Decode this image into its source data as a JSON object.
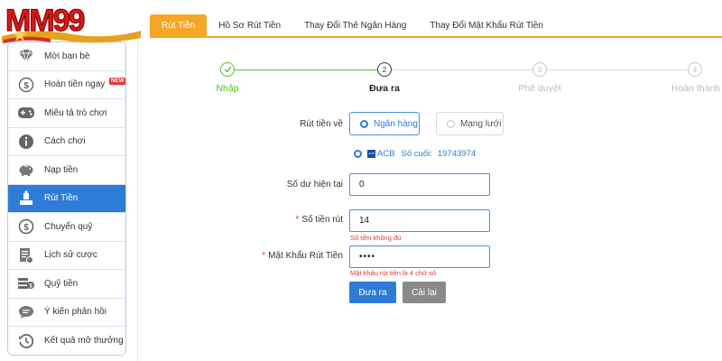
{
  "logo": {
    "text": "MM99"
  },
  "sidebar": {
    "items": [
      {
        "label": "Mời bạn bè"
      },
      {
        "label": "Hoàn tiền ngay",
        "badge": "NEW"
      },
      {
        "label": "Miêu tả trò chơi"
      },
      {
        "label": "Cách chơi"
      },
      {
        "label": "Nạp tiền"
      },
      {
        "label": "Rút Tiền",
        "active": true
      },
      {
        "label": "Chuyển quỹ"
      },
      {
        "label": "Lịch sử cược"
      },
      {
        "label": "Quỹ tiền"
      },
      {
        "label": "Ý kiến phản hồi"
      },
      {
        "label": "Kết quả mở thưởng"
      }
    ]
  },
  "tabs": [
    {
      "label": "Rút Tiền",
      "active": true
    },
    {
      "label": "Hồ Sơ Rút Tiền"
    },
    {
      "label": "Thay Đổi Thẻ Ngân Hàng"
    },
    {
      "label": "Thay Đổi Mật Khẩu Rút Tiền"
    }
  ],
  "steps": [
    {
      "number": "✓",
      "label": "Nhập",
      "state": "done"
    },
    {
      "number": "2",
      "label": "Đưa ra",
      "state": "current"
    },
    {
      "number": "3",
      "label": "Phê duyệt",
      "state": "pending"
    },
    {
      "number": "4",
      "label": "Hoàn thành",
      "state": "pending"
    }
  ],
  "form": {
    "method_label": "Rút tiền về",
    "method_bank": "Ngân hàng",
    "method_network": "Mạng lưới",
    "bank_logo": "ACB",
    "bank_name": "ACB",
    "last_digits_label": "Số cuối:",
    "last_digits": "19743974",
    "balance_label": "Số dư hiện tại",
    "balance_value": "0",
    "amount_label": "Số tiền rút",
    "amount_value": "14",
    "amount_error": "Số tiền không đủ",
    "password_label": "Mật Khẩu Rút Tiền",
    "password_value": "••••",
    "password_error": "Mật khẩu rút tiền là 4 chữ số",
    "submit_label": "Đưa ra",
    "reset_label": "Cài lại"
  },
  "colors": {
    "primary": "#2f7bd8",
    "accent": "#f6a623",
    "success": "#52c41a",
    "error": "#e53935",
    "reset": "#8a8a8a"
  }
}
